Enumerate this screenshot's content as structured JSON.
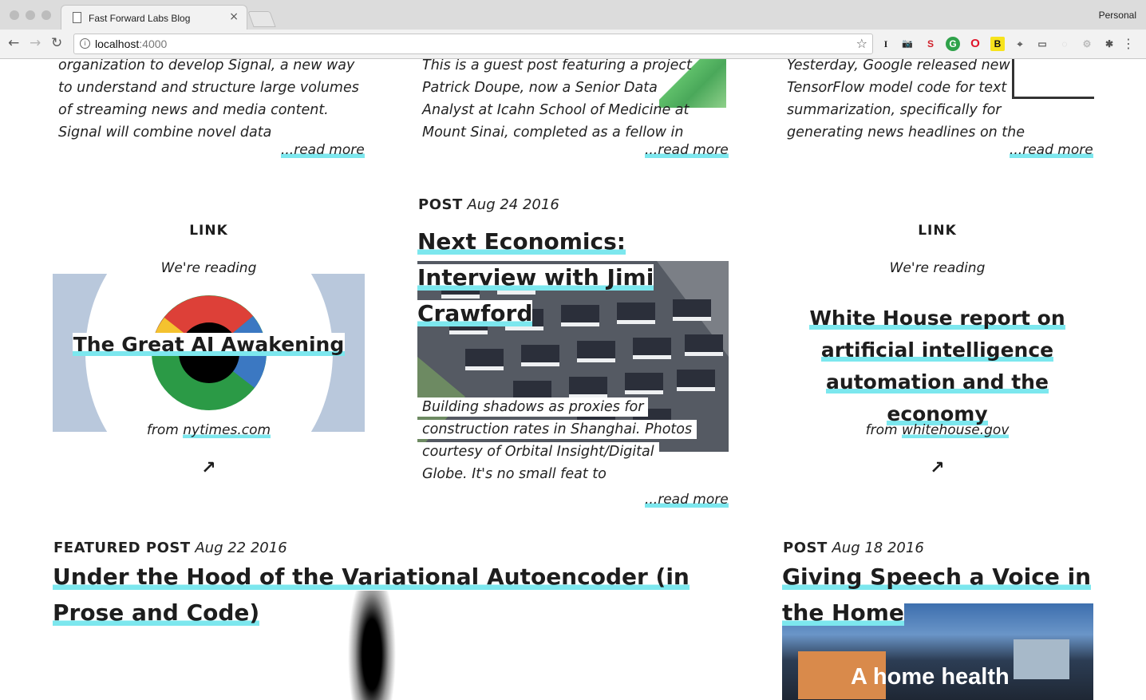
{
  "browser": {
    "tab_title": "Fast Forward Labs Blog",
    "tab_close": "×",
    "profile": "Personal",
    "url_host": "localhost",
    "url_port": ":4000",
    "info_icon": "i",
    "star_icon": "☆",
    "menu_icon": "⋮",
    "nav": {
      "back": "←",
      "forward": "→",
      "reload": "↻"
    },
    "extensions": [
      "I",
      "📷",
      "S",
      "G",
      "O",
      "B",
      "⌖",
      "▭",
      "◌",
      "⚙",
      "✱"
    ]
  },
  "row1": {
    "col1": {
      "excerpt": "organization to develop Signal, a new way to understand and structure large volumes of streaming news and media content. Signal will combine novel data",
      "read_more": "...read more"
    },
    "col2": {
      "excerpt": "This is a guest post featuring a project Patrick Doupe, now a Senior Data Analyst at Icahn School of Medicine at Mount Sinai, completed as a fellow in",
      "read_more": "...read more"
    },
    "col3": {
      "excerpt": "Yesterday, Google released new TensorFlow model code for text summarization, specifically for generating news headlines on the",
      "read_more": "...read more"
    }
  },
  "row2": {
    "link1": {
      "label": "LINK",
      "reading": "We're reading",
      "title": "The Great AI Awakening",
      "from_prefix": "from ",
      "domain": "nytimes.com",
      "arrow": "↗"
    },
    "post": {
      "kind": "POST",
      "date": "Aug 24 2016",
      "title": "Next Economics: Interview with Jimi Crawford",
      "excerpt": "Building shadows as proxies for construction rates in Shanghai. Photos courtesy of Orbital Insight/Digital Globe.  It's no small feat to",
      "read_more": "...read more"
    },
    "link2": {
      "label": "LINK",
      "reading": "We're reading",
      "title": "White House report on artificial intelligence automation and the economy",
      "from_prefix": "from ",
      "domain": "whitehouse.gov",
      "arrow": "↗"
    }
  },
  "row3": {
    "featured": {
      "kind": "FEATURED POST",
      "date": "Aug 22 2016",
      "title": "Under the Hood of the Variational Autoencoder (in Prose and Code)"
    },
    "post": {
      "kind": "POST",
      "date": "Aug 18 2016",
      "title": "Giving Speech a Voice in the Home",
      "image_caption": "A home health"
    }
  },
  "colors": {
    "underline_accent": "#7ce7ee",
    "text": "#1d1d1d"
  }
}
